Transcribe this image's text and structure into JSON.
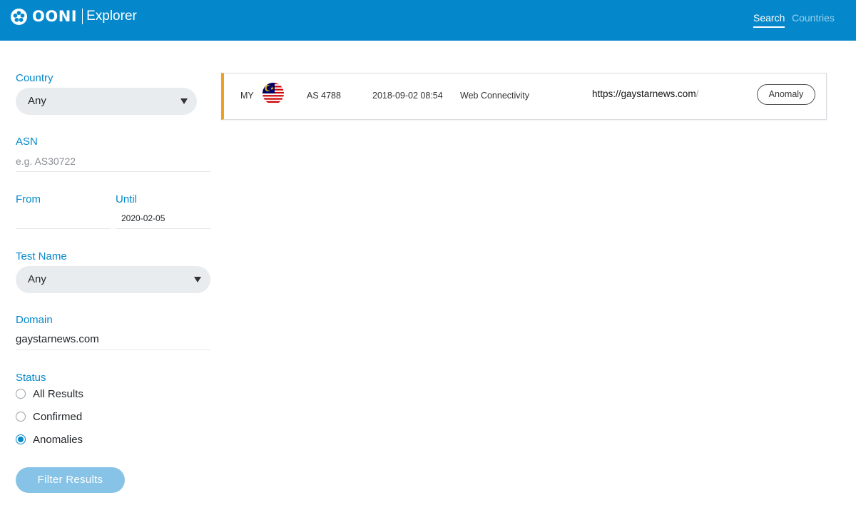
{
  "header": {
    "brand_main": "OONI",
    "brand_sub": "Explorer",
    "nav": [
      {
        "label": "Search",
        "active": true
      },
      {
        "label": "Countries",
        "active": false
      }
    ]
  },
  "filters": {
    "country": {
      "label": "Country",
      "value": "Any"
    },
    "asn": {
      "label": "ASN",
      "placeholder": "e.g. AS30722",
      "value": ""
    },
    "from": {
      "label": "From",
      "value": ""
    },
    "until": {
      "label": "Until",
      "value": "2020-02-05"
    },
    "test_name": {
      "label": "Test Name",
      "value": "Any"
    },
    "domain": {
      "label": "Domain",
      "value": "gaystarnews.com"
    },
    "status": {
      "label": "Status",
      "options": [
        {
          "label": "All Results",
          "checked": false
        },
        {
          "label": "Confirmed",
          "checked": false
        },
        {
          "label": "Anomalies",
          "checked": true
        }
      ]
    },
    "submit_label": "Filter Results"
  },
  "results": [
    {
      "country_code": "MY",
      "flag_icon": "malaysia-flag-icon",
      "asn": "AS 4788",
      "date": "2018-09-02 08:54",
      "test": "Web Connectivity",
      "url": "https://gaystarnews.com",
      "url_trailer": "/",
      "status_badge": "Anomaly",
      "accent_color": "#f0a01e"
    }
  ],
  "colors": {
    "header_bg": "#0588cb",
    "label_blue": "#0588cb",
    "button_bg": "#86c3e6",
    "anomaly_accent": "#f0a01e"
  }
}
